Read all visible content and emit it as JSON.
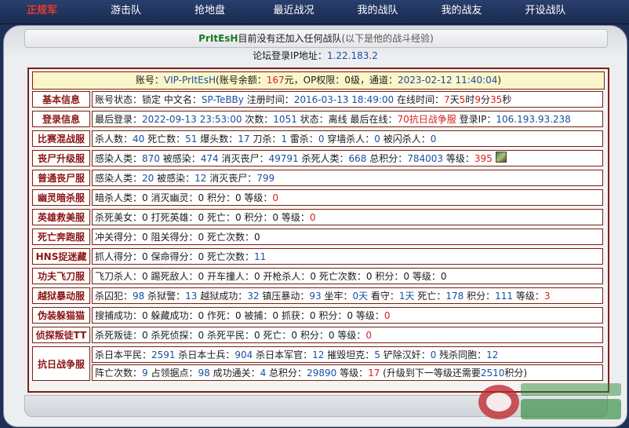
{
  "nav": {
    "items": [
      "正规军",
      "游击队",
      "抢地盘",
      "最近战况",
      "我的战队",
      "我的战友",
      "开设战队"
    ]
  },
  "header": {
    "username": "PrItEsH",
    "message": "目前没有还加入任何战队",
    "note": "(以下是他的战斗经验)",
    "ip_label": "论坛登录IP地址：",
    "ip_value": "1.22.183.2"
  },
  "account": {
    "k1": "账号：",
    "account_name": "VIP-PrItEsH",
    "k2": "(账号余额：",
    "balance": "167",
    "k3": "元，OP权限：0级，通道：",
    "date": "2023-02-12 11:40:04",
    "k4": ")"
  },
  "rows": {
    "basic": {
      "label": "基本信息",
      "t1": "账号状态：锁定 中文名：",
      "cname": "SP-TeBBy",
      "t2": " 注册时间：",
      "reg": "2016-03-13 18:49:00",
      "t3": " 在线时间：",
      "d": "7",
      "t4": "天",
      "h": "5",
      "t5": "时",
      "m": "9",
      "t6": "分",
      "s": "35",
      "t7": "秒"
    },
    "login": {
      "label": "登录信息",
      "t1": "最后登录：",
      "last": "2022-09-13 23:53:00",
      "t2": " 次数：",
      "count": "1051",
      "t3": " 状态：",
      "status": "离线",
      "t4": " 最后在线：",
      "server": "70抗日战争服",
      "t5": " 登录IP：",
      "ip": "106.193.93.238"
    },
    "mix": {
      "label": "比赛混战服",
      "t1": "杀人数：",
      "v1": "40",
      "t2": " 死亡数：",
      "v2": "51",
      "t3": " 爆头数：",
      "v3": "17",
      "t4": " 刀杀：",
      "v4": "1",
      "t5": " 雷杀：",
      "v5": "0",
      "t6": " 穿墙杀人：",
      "v6": "0",
      "t7": " 被闪杀人：",
      "v7": "0"
    },
    "zombie": {
      "label": "丧尸升级服",
      "t1": "感染人类：",
      "v1": "870",
      "t2": " 被感染：",
      "v2": "474",
      "t3": " 消灭丧尸：",
      "v3": "49791",
      "t4": " 杀死人类：",
      "v4": "668",
      "t5": " 总积分：",
      "v5": "784003",
      "t6": " 等级：",
      "v6": "395"
    },
    "plain": {
      "label": "普通丧尸服",
      "t1": "感染人类：",
      "v1": "20",
      "t2": " 被感染：",
      "v2": "12",
      "t3": " 消灭丧尸：",
      "v3": "799"
    },
    "ghost": {
      "label": "幽灵暗杀服",
      "t1": "暗杀人类：",
      "v1": "0",
      "t2": " 消灭幽灵：",
      "v2": "0",
      "t3": " 积分：",
      "v3": "0",
      "t4": " 等级：",
      "v4": "0"
    },
    "hero": {
      "label": "英雄救美服",
      "t1": "杀死美女：",
      "v1": "0",
      "t2": " 打死英雄：",
      "v2": "0",
      "t3": " 死亡：",
      "v3": "0",
      "t4": " 积分：",
      "v4": "0",
      "t5": " 等级：",
      "v5": "0"
    },
    "death": {
      "label": "死亡奔跑服",
      "t1": "冲关得分：",
      "v1": "0",
      "t2": " 阻关得分：",
      "v2": "0",
      "t3": " 死亡次数：",
      "v3": "0"
    },
    "hns": {
      "label": "HNS捉迷藏",
      "t1": "抓人得分：",
      "v1": "0",
      "t2": " 保命得分：",
      "v2": "0",
      "t3": " 死亡次数：",
      "v3": "11"
    },
    "kungfu": {
      "label": "功夫飞刀服",
      "t1": "飞刀杀人：",
      "v1": "0",
      "t2": " 踢死敌人：",
      "v2": "0",
      "t3": " 开车撞人：",
      "v3": "0",
      "t4": " 开枪杀人：",
      "v4": "0",
      "t5": " 死亡次数：",
      "v5": "0",
      "t6": " 积分：",
      "v6": "0",
      "t7": " 等级：",
      "v7": "0"
    },
    "prison": {
      "label": "越狱暴动服",
      "t1": "杀囚犯：",
      "v1": "98",
      "t2": " 杀狱警：",
      "v2": "13",
      "t3": " 越狱成功：",
      "v3": "32",
      "t4": " 镇压暴动：",
      "v4": "93",
      "t5": " 坐牢：",
      "v5": "0天",
      "t6": " 看守：",
      "v6": "1天",
      "t7": " 死亡：",
      "v7": "178",
      "t8": " 积分：",
      "v8": "111",
      "t9": " 等级：",
      "v9": "3"
    },
    "hide": {
      "label": "伪装躲猫猫",
      "t1": "搜捕成功：",
      "v1": "0",
      "t2": " 躲藏成功：",
      "v2": "0",
      "t3": " 作死：",
      "v3": "0",
      "t4": " 被捕：",
      "v4": "0",
      "t5": " 抓获：",
      "v5": "0",
      "t6": " 积分：",
      "v6": "0",
      "t7": " 等级：",
      "v7": "0"
    },
    "detect": {
      "label": "侦探叛徒TT",
      "t1": "杀死叛徒：",
      "v1": "0",
      "t2": " 杀死侦探：",
      "v2": "0",
      "t3": " 杀死平民：",
      "v3": "0",
      "t4": " 死亡：",
      "v4": "0",
      "t5": " 积分：",
      "v5": "0",
      "t6": " 等级：",
      "v6": "0"
    },
    "war": {
      "label": "抗日战争服",
      "a1": "杀日本平民：",
      "av1": "2591",
      "a2": " 杀日本士兵：",
      "av2": "904",
      "a3": " 杀日本军官：",
      "av3": "12",
      "a4": " 摧毁坦克：",
      "av4": "5",
      "a5": " 铲除汉奸：",
      "av5": "0",
      "a6": " 残杀同胞：",
      "av6": "12",
      "b1": "阵亡次数：",
      "bv1": "9",
      "b2": " 占领据点：",
      "bv2": "98",
      "b3": " 成功通关：",
      "bv3": "4",
      "b4": " 总积分：",
      "bv4": "29890",
      "b5": " 等级：",
      "bv5": "17",
      "b6": " (升级到下一等级还需要",
      "bv6": "2510",
      "b7": "积分)"
    }
  },
  "colors": {
    "nav_bg": "#1a2a50",
    "label_red": "#8c1515",
    "value_blue": "#1a4fa0",
    "highlight_red": "#d61f1f",
    "border": "#7b2211"
  },
  "icons": {
    "level_badge": "level-badge-icon",
    "watermark": "watermark-logo"
  }
}
